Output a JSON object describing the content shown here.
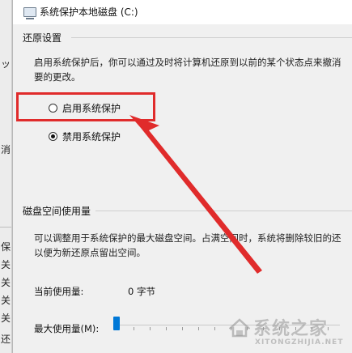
{
  "background_window": {
    "fragments": [
      "ッ",
      "消",
      "保",
      "关",
      "关",
      "关",
      "关",
      "还"
    ]
  },
  "dialog": {
    "title": "系统保护本地磁盘 (C:)",
    "restore_settings": {
      "heading": "还原设置",
      "description_line1": "启用系统保护后，你可以通过及时将计算机还原到以前的某个状态点来撤消",
      "description_line2": "要的更改。",
      "options": [
        {
          "label": "启用系统保护",
          "checked": false
        },
        {
          "label": "禁用系统保护",
          "checked": true
        }
      ]
    },
    "disk_usage": {
      "heading": "磁盘空间使用量",
      "description_line1": "可以调整用于系统保护的最大磁盘空间。占满空间时，系统将删除较旧的还",
      "description_line2": "以便为新还原点留出空间。",
      "current_usage_label": "当前使用量:",
      "current_usage_value": "0 字节",
      "max_usage_label": "最大使用量(M):",
      "max_usage_level": 0
    }
  },
  "colors": {
    "annotation_red": "#e02b2b",
    "slider_blue": "#0078d7"
  },
  "watermark": {
    "text": "系统之家",
    "subtext": "XITONGZHIJIA.NET"
  }
}
